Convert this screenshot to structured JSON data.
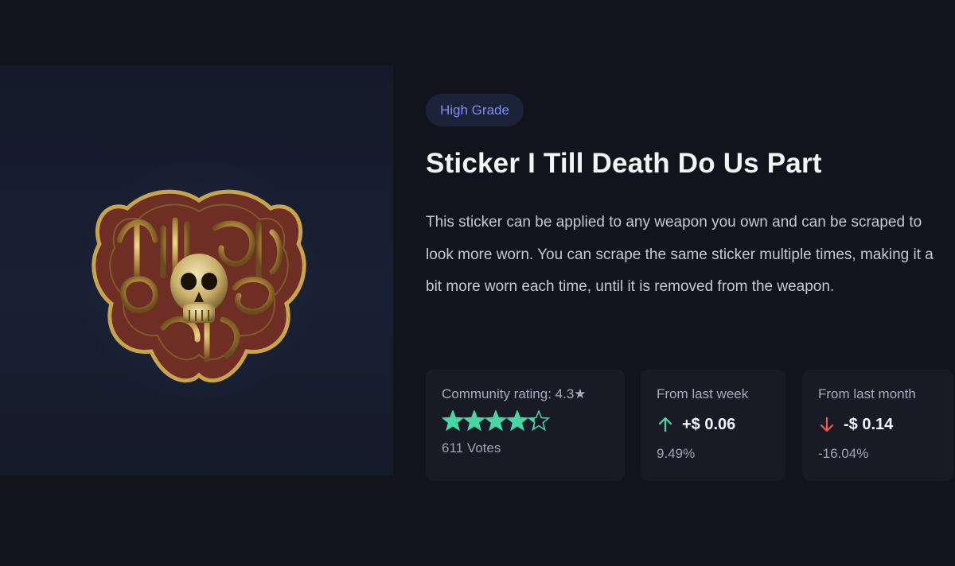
{
  "item": {
    "grade": "High Grade",
    "title": "Sticker I Till Death Do Us Part",
    "description": "This sticker can be applied to any weapon you own and can be scraped to look more worn. You can scrape the same sticker multiple times, making it a bit more worn each time, until it is removed from the weapon.",
    "image_icon": "skull-sticker-image"
  },
  "rating": {
    "label": "Community rating: 4.3★",
    "value": 4.3,
    "max": 5,
    "votes": "611 Votes",
    "star_color": "#47d6a4"
  },
  "week": {
    "label": "From last week",
    "direction": "up",
    "change": "+$ 0.06",
    "percent": "9.49%",
    "arrow_color": "#47d6a4"
  },
  "month": {
    "label": "From last month",
    "direction": "down",
    "change": "-$ 0.14",
    "percent": "-16.04%",
    "arrow_color": "#f0584f"
  },
  "colors": {
    "background": "#12141d",
    "card": "#181b26",
    "accent": "#7d8cf5"
  }
}
